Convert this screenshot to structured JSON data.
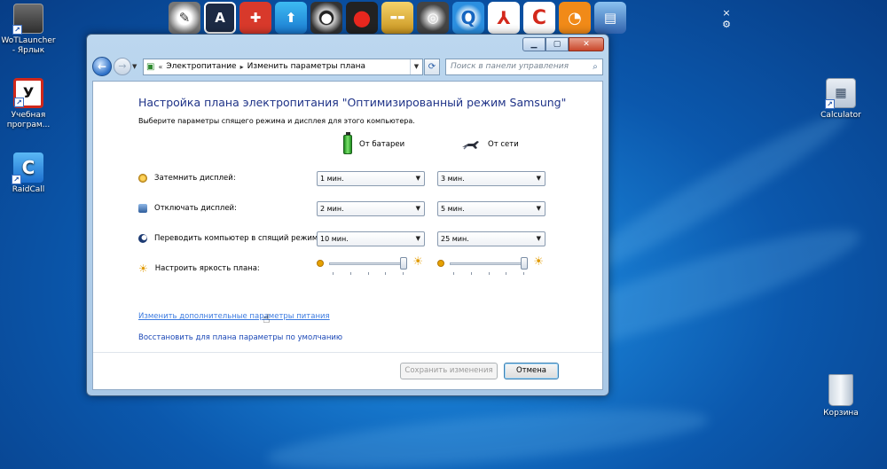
{
  "dock": {
    "icons": [
      "magnifier-tool-icon",
      "text-box-icon",
      "rescue-tool-icon",
      "share-icon",
      "webcam-icon",
      "record-icon",
      "folder-icon",
      "film-reel-icon",
      "quicktime-icon",
      "pdf-reader-icon",
      "ccleaner-icon",
      "speedtest-icon",
      "installer-icon"
    ],
    "close_glyph": "×",
    "settings_glyph": "⚙"
  },
  "desktop": {
    "icons": [
      {
        "label": "WoTLauncher - Ярлык"
      },
      {
        "label": "Учебная програм..."
      },
      {
        "label": "RaidCall"
      },
      {
        "label": "Calculator"
      },
      {
        "label": "Корзина"
      }
    ]
  },
  "window": {
    "controls": {
      "minimize": "▁",
      "maximize": "▢",
      "close": "✕"
    },
    "breadcrumb": {
      "prefix": "«",
      "items": [
        "Электропитание",
        "Изменить параметры плана"
      ],
      "separator": "▸"
    },
    "search": {
      "placeholder": "Поиск в панели управления"
    },
    "heading": "Настройка плана электропитания \"Оптимизированный режим Samsung\"",
    "subheading": "Выберите параметры спящего режима и дисплея для этого компьютера.",
    "columns": {
      "battery": "От батареи",
      "ac": "От сети"
    },
    "settings": [
      {
        "label": "Затемнить дисплей:",
        "battery": "1 мин.",
        "ac": "3 мин."
      },
      {
        "label": "Отключать дисплей:",
        "battery": "2 мин.",
        "ac": "5 мин."
      },
      {
        "label": "Переводить компьютер в спящий режим:",
        "battery": "10 мин.",
        "ac": "25 мин."
      }
    ],
    "brightness": {
      "label": "Настроить яркость плана:",
      "battery_level": 0.95,
      "ac_level": 0.95
    },
    "links": {
      "advanced": "Изменить дополнительные параметры питания",
      "restore": "Восстановить для плана параметры по умолчанию"
    },
    "buttons": {
      "save": "Сохранить изменения",
      "cancel": "Отмена"
    }
  }
}
